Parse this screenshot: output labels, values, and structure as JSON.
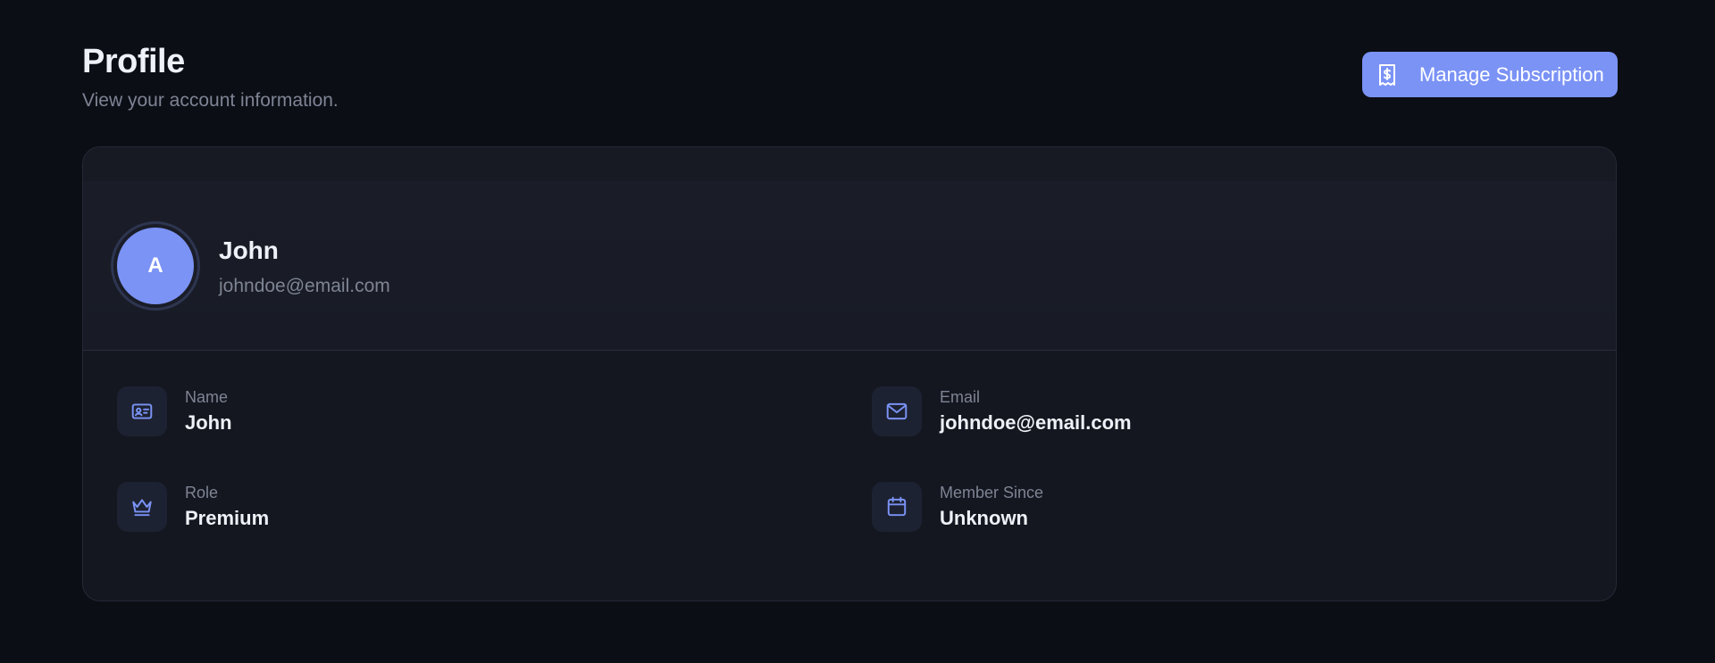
{
  "header": {
    "title": "Profile",
    "subtitle": "View your account information."
  },
  "actions": {
    "manage_subscription_label": "Manage Subscription",
    "manage_subscription_icon": "receipt-dollar-icon"
  },
  "profile": {
    "avatar_initial": "A",
    "name": "John",
    "email": "johndoe@email.com"
  },
  "details": [
    {
      "icon": "id-card-icon",
      "label": "Name",
      "value": "John"
    },
    {
      "icon": "mail-icon",
      "label": "Email",
      "value": "johndoe@email.com"
    },
    {
      "icon": "crown-icon",
      "label": "Role",
      "value": "Premium"
    },
    {
      "icon": "calendar-icon",
      "label": "Member Since",
      "value": "Unknown"
    }
  ],
  "colors": {
    "background": "#0b0e15",
    "card": "#141720",
    "accent": "#7b93f5",
    "muted_text": "#7e8494"
  }
}
